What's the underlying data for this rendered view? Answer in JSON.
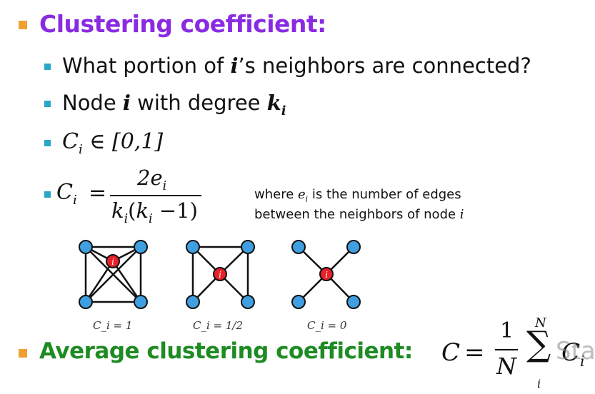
{
  "heading": "Clustering coefficient:",
  "bullets": {
    "q_pre": "What portion of ",
    "q_var": "i",
    "q_post": "’s neighbors are connected?",
    "node_pre": "Node ",
    "node_i": "i",
    "node_mid": " with degree ",
    "node_k": "k",
    "node_ksub": "i",
    "range_c": "C",
    "range_sub": "i",
    "range_rest": " ∈ [0,1]"
  },
  "formula": {
    "lhs": "C",
    "lhs_sub": "i",
    "eq": "=",
    "num": "2e",
    "num_sub": "i",
    "den_k1": "k",
    "den_k1_sub": "i",
    "den_open": "(",
    "den_k2": "k",
    "den_k2_sub": "i",
    "den_rest": " −1)"
  },
  "note": {
    "l1_pre": "where ",
    "l1_e": "e",
    "l1_sub": "i",
    "l1_post": " is the number of edges",
    "l2_pre": "between the neighbors of node ",
    "l2_i": "i"
  },
  "graphs": [
    {
      "center_label": "i",
      "caption": "C_i = 1"
    },
    {
      "center_label": "i",
      "caption": "C_i = 1/2"
    },
    {
      "center_label": "i",
      "caption": "C_i = 0"
    }
  ],
  "average": {
    "label": "Average clustering coefficient:",
    "c": "C",
    "eq": "=",
    "frac_num": "1",
    "frac_den": "N",
    "sum_top": "N",
    "sum_bot": "i",
    "term": "C",
    "term_sub": "i",
    "overlay": "Sta"
  },
  "colors": {
    "purple": "#8a2be2",
    "green": "#1e8b23",
    "orange_bullet": "#f0a030",
    "teal_bullet": "#2aa6c8",
    "node_blue": "#3f9fe0",
    "node_red": "#e8202a"
  }
}
